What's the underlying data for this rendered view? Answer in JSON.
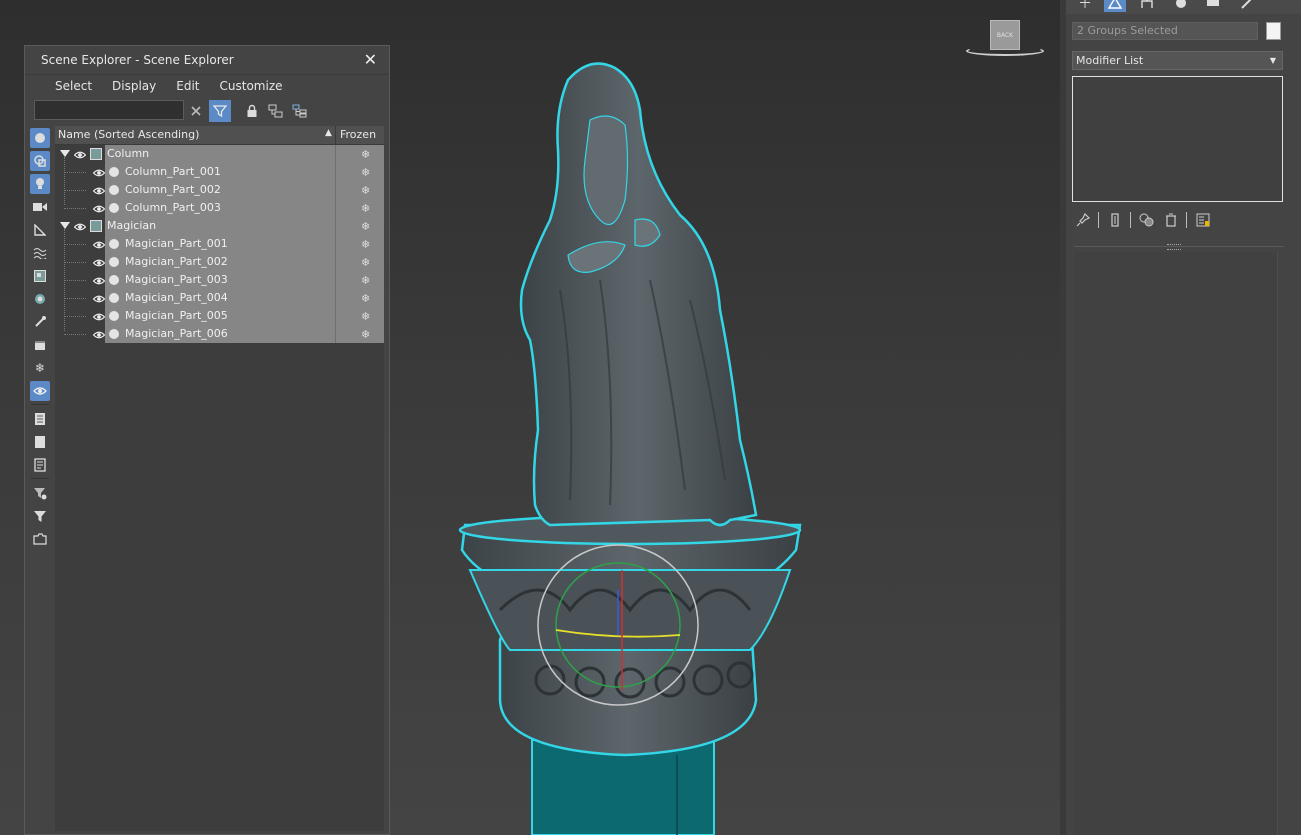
{
  "viewport": {
    "viewcube_label": "BACK"
  },
  "scene_explorer": {
    "title": "Scene Explorer - Scene Explorer",
    "close_glyph": "✕",
    "menu": [
      "Select",
      "Display",
      "Edit",
      "Customize"
    ],
    "search_value": "",
    "columns": {
      "name": "Name (Sorted Ascending)",
      "sort_glyph": "▲",
      "frozen": "Frozen"
    },
    "tree": [
      {
        "label": "Column",
        "type": "group",
        "children": [
          "Column_Part_001",
          "Column_Part_002",
          "Column_Part_003"
        ]
      },
      {
        "label": "Magician",
        "type": "group",
        "children": [
          "Magician_Part_001",
          "Magician_Part_002",
          "Magician_Part_003",
          "Magician_Part_004",
          "Magician_Part_005",
          "Magician_Part_006"
        ]
      }
    ],
    "frozen_glyph": "❄"
  },
  "command_panel": {
    "object_name": "2 Groups Selected",
    "modifier_list": "Modifier List",
    "swatch_color": "#f4f4f4"
  },
  "colors": {
    "selection_outline": "#33d6e6",
    "accent": "#5b8ac6"
  }
}
